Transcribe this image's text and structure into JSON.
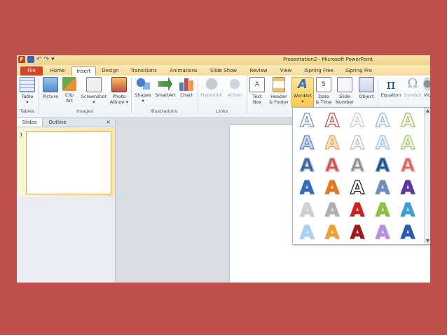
{
  "window": {
    "title": "Presentation2 - Microsoft PowerPoint"
  },
  "qat": {
    "logo": "P",
    "undo": "↶",
    "redo": "↷",
    "customize": "▾"
  },
  "tabs": [
    "File",
    "Home",
    "Insert",
    "Design",
    "Transitions",
    "Animations",
    "Slide Show",
    "Review",
    "View",
    "iSpring Free",
    "iSpring Pro"
  ],
  "ribbon": {
    "table": {
      "label": "Table",
      "arrow": "▾"
    },
    "picture": {
      "label": "Picture"
    },
    "clipart": {
      "label1": "Clip",
      "label2": "Art"
    },
    "screenshot": {
      "label": "Screenshot",
      "arrow": "▾"
    },
    "photoalbum": {
      "label1": "Photo",
      "label2": "Album ▾"
    },
    "shapes": {
      "label": "Shapes",
      "arrow": "▾"
    },
    "smartart": {
      "label": "SmartArt"
    },
    "chart": {
      "label": "Chart"
    },
    "hyperlink": {
      "label": "Hyperlink"
    },
    "action": {
      "label": "Action"
    },
    "textbox": {
      "label1": "Text",
      "label2": "Box"
    },
    "headerfooter": {
      "label1": "Header",
      "label2": "& Footer"
    },
    "wordart": {
      "label": "WordArt",
      "arrow": "▾"
    },
    "datetime": {
      "label1": "Date",
      "label2": "& Time"
    },
    "slidenumber": {
      "label1": "Slide",
      "label2": "Number"
    },
    "object": {
      "label": "Object"
    },
    "equation": {
      "label": "Equation",
      "glyph": "π"
    },
    "symbol": {
      "label": "Symbol",
      "glyph": "Ω"
    },
    "video": {
      "label": "Vid"
    },
    "groups": {
      "tables": "Tables",
      "images": "Images",
      "illustrations": "Illustrations",
      "links": "Links"
    }
  },
  "pane": {
    "tab_slides": "Slides",
    "tab_outline": "Outline",
    "close": "×",
    "slide_number": "1"
  },
  "gallery": {
    "letter": "A",
    "scroll_up": "▲",
    "scroll_down": "▼",
    "styles": [
      {
        "name": "blue-outline",
        "color": "#ffffff",
        "stroke": "#6f90c4"
      },
      {
        "name": "red-outline",
        "color": "#ffffff",
        "stroke": "#c9464a"
      },
      {
        "name": "gray-outline",
        "color": "#ffffff",
        "stroke": "#c4c8cc"
      },
      {
        "name": "light-blue-outline",
        "color": "#ffffff",
        "stroke": "#8fb0d8"
      },
      {
        "name": "green-outline",
        "color": "#ffffff",
        "stroke": "#9bbb59"
      },
      {
        "name": "blue-gradient",
        "color": "#c9d8ee",
        "stroke": "#5b84c4"
      },
      {
        "name": "orange-outline",
        "color": "#fde6c8",
        "stroke": "#f0a04a"
      },
      {
        "name": "white-gray",
        "color": "#ffffff",
        "stroke": "#bcbcbc"
      },
      {
        "name": "sky-blue",
        "color": "#e4eef8",
        "stroke": "#9cc0e2"
      },
      {
        "name": "lime",
        "color": "#e8f2d6",
        "stroke": "#a6c47a"
      },
      {
        "name": "navy-fill",
        "color": "#3a5fa0",
        "stroke": "#9cb8e0"
      },
      {
        "name": "red-fill",
        "color": "#d05050",
        "stroke": "#f0b0b0"
      },
      {
        "name": "silver",
        "color": "#909090",
        "stroke": "#e0e0e0"
      },
      {
        "name": "dark-blue",
        "color": "#1f4e8c",
        "stroke": "#7aa0d4"
      },
      {
        "name": "salmon",
        "color": "#e06060",
        "stroke": "#f4c0c0"
      },
      {
        "name": "bright-blue",
        "color": "#2f6cc0",
        "stroke": "#2f6cc0"
      },
      {
        "name": "orange-fill",
        "color": "#e07a20",
        "stroke": "#e07a20"
      },
      {
        "name": "black-outline",
        "color": "#ffffff",
        "stroke": "#202020"
      },
      {
        "name": "steel-blue",
        "color": "#6a8fc0",
        "stroke": "#6a8fc0"
      },
      {
        "name": "purple",
        "color": "#5a3aa0",
        "stroke": "#5a3aa0"
      },
      {
        "name": "gray-light",
        "color": "#d0d0d0",
        "stroke": "#d0d0d0"
      },
      {
        "name": "gray-mid",
        "color": "#b0b0b0",
        "stroke": "#b0b0b0"
      },
      {
        "name": "red-bold",
        "color": "#d02020",
        "stroke": "#d02020"
      },
      {
        "name": "green-bold",
        "color": "#8cc040",
        "stroke": "#8cc040"
      },
      {
        "name": "aqua",
        "color": "#3aa0d8",
        "stroke": "#3aa0d8"
      },
      {
        "name": "light-blue-glow",
        "color": "#a8d0f0",
        "stroke": "#a8d0f0"
      },
      {
        "name": "orange-glow",
        "color": "#f0a030",
        "stroke": "#f0a030"
      },
      {
        "name": "dark-red",
        "color": "#a01818",
        "stroke": "#a01818"
      },
      {
        "name": "lavender",
        "color": "#b890e0",
        "stroke": "#b890e0"
      },
      {
        "name": "deep-blue",
        "color": "#2a5ab0",
        "stroke": "#2a5ab0"
      }
    ]
  }
}
